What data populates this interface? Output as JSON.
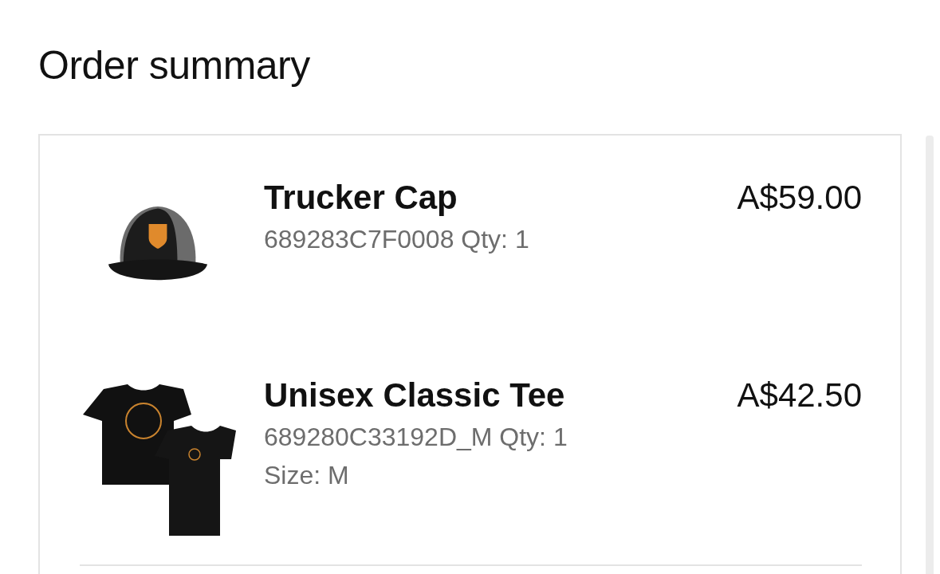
{
  "title": "Order summary",
  "items": [
    {
      "kind": "cap",
      "name": "Trucker Cap",
      "details": [
        "689283C7F0008 Qty: 1"
      ],
      "price": "A$59.00"
    },
    {
      "kind": "tee",
      "name": "Unisex Classic Tee",
      "details": [
        "689280C33192D_M Qty: 1",
        "Size: M"
      ],
      "price": "A$42.50"
    }
  ]
}
